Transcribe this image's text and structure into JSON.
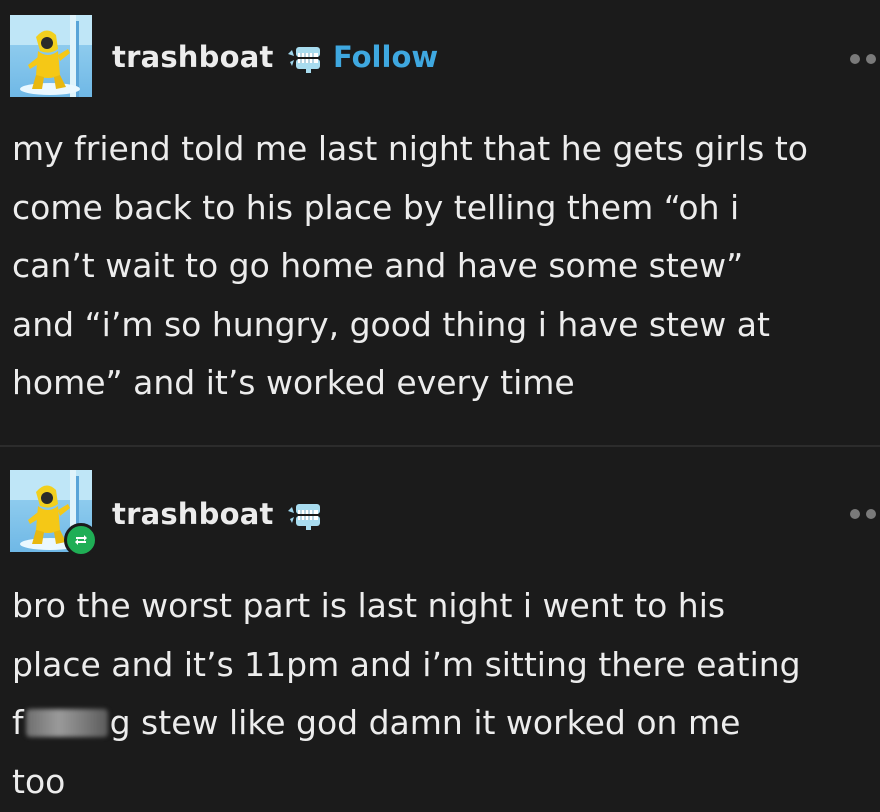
{
  "posts": [
    {
      "username": "trashboat",
      "follow_label": "Follow",
      "badge_icon": "chattering-teeth-icon",
      "avatar_icon": "yellow-raincoat-character-avatar",
      "body": "my friend told me last night that he gets girls to\ncome back to his place by telling them “oh i\ncan’t wait to go home and have some stew”\nand “i’m so hungry, good thing i have stew at\nhome” and it’s worked every time"
    },
    {
      "username": "trashboat",
      "badge_icon": "chattering-teeth-icon",
      "avatar_icon": "yellow-raincoat-character-avatar",
      "reblog_icon": "reblog-icon",
      "body_before_censor": "bro the worst part is last night i went to his\nplace and it’s 11pm and i’m sitting there eating\nf",
      "body_after_censor": "g stew like god damn it worked on me\ntoo"
    }
  ],
  "colors": {
    "background": "#1b1b1b",
    "text": "#ececec",
    "follow": "#3fa8e0",
    "reblog_badge": "#1fae55",
    "menu_dots": "#7a7a7a"
  }
}
